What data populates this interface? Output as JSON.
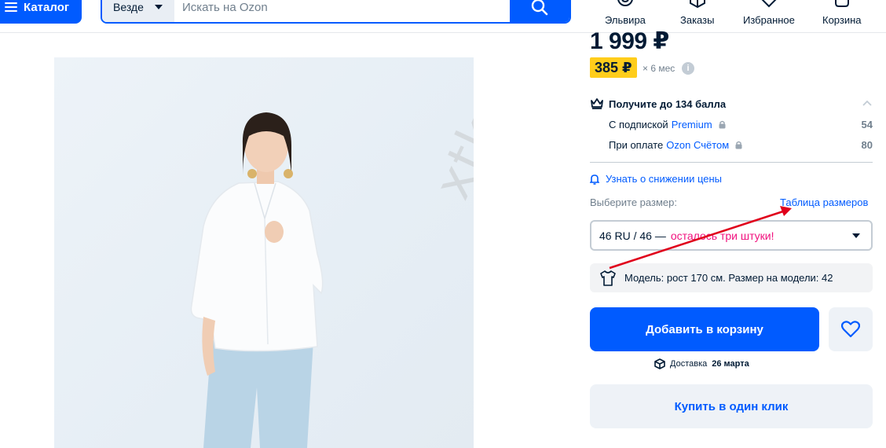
{
  "header": {
    "catalog_label": "Каталог",
    "search_scope": "Везде",
    "search_placeholder": "Искать на Ozon",
    "nav": [
      {
        "label": "Эльвира",
        "icon": "smile-icon"
      },
      {
        "label": "Заказы",
        "icon": "box-icon"
      },
      {
        "label": "Избранное",
        "icon": "heart-icon"
      },
      {
        "label": "Корзина",
        "icon": "cart-icon"
      }
    ]
  },
  "product": {
    "image_alt": "",
    "watermark": "xtkani.ru"
  },
  "price": {
    "main": "1 999 ₽",
    "installment_amount": "385 ₽",
    "installment_term": "× 6 мес",
    "info_glyph": "i"
  },
  "bonus": {
    "title": "Получите до 134 балла",
    "rows": [
      {
        "prefix": "С подпиской",
        "link": "Premium",
        "value": "54"
      },
      {
        "prefix": "При оплате",
        "link": "Ozon Счётом",
        "value": "80"
      }
    ]
  },
  "notify_label": "Узнать о снижении цены",
  "size": {
    "label": "Выберите размер:",
    "table_link": "Таблица размеров",
    "selected": "46 RU / 46 —",
    "warning": "осталось три штуки!"
  },
  "model_info": "Модель: рост 170 см. Размер на модели: 42",
  "actions": {
    "add_to_cart": "Добавить в корзину",
    "delivery_prefix": "Доставка",
    "delivery_date": "26 марта",
    "buy_one_click": "Купить в один клик"
  },
  "colors": {
    "brand": "#005bff",
    "installment_badge": "#ffcd1b",
    "warning": "#f1117e",
    "annotation_arrow": "#e0001b"
  }
}
